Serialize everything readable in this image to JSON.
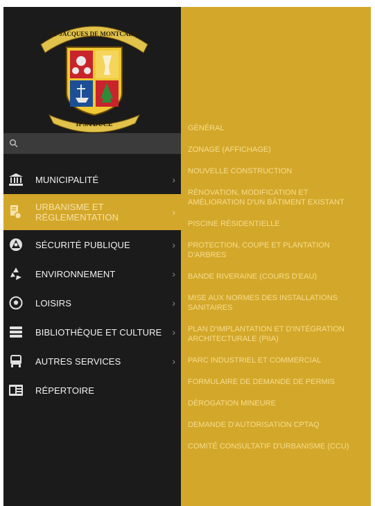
{
  "logo": {
    "banner_top": "ST-JACQUES DE MONTCALM",
    "banner_bottom": "IPSA DUCE"
  },
  "search": {
    "icon": "search-icon"
  },
  "colors": {
    "sidebar_bg": "#1b1b1b",
    "accent": "#d3a72a",
    "submenu_text": "#f6de8e",
    "search_bg": "#3b3b3b"
  },
  "nav": {
    "items": [
      {
        "label": "MUNICIPALITÉ",
        "icon": "bank-icon",
        "chevron": "›"
      },
      {
        "label": "URBANISME ET RÉGLEMENTATION",
        "icon": "document-settings-icon",
        "chevron": "›",
        "active": true
      },
      {
        "label": "SÉCURITÉ PUBLIQUE",
        "icon": "emergency-icon",
        "chevron": "›"
      },
      {
        "label": "ENVIRONNEMENT",
        "icon": "recycle-icon",
        "chevron": "›"
      },
      {
        "label": "LOISIRS",
        "icon": "soccer-ball-icon",
        "chevron": "›"
      },
      {
        "label": "BIBLIOTHÈQUE ET CULTURE",
        "icon": "books-icon",
        "chevron": "›"
      },
      {
        "label": "AUTRES SERVICES",
        "icon": "bus-icon",
        "chevron": "›"
      },
      {
        "label": "RÉPERTOIRE",
        "icon": "directory-icon"
      }
    ]
  },
  "submenu": {
    "items": [
      "GÉNÉRAL",
      "ZONAGE (AFFICHAGE)",
      "NOUVELLE CONSTRUCTION",
      "RÉNOVATION, MODIFICATION ET AMÉLIORATION D'UN BÂTIMENT EXISTANT",
      "PISCINE RÉSIDENTIELLE",
      "PROTECTION, COUPE ET PLANTATION D'ARBRES",
      "BANDE RIVERAINE (COURS D'EAU)",
      "MISE AUX NORMES DES INSTALLATIONS SANITAIRES",
      "PLAN D'IMPLANTATION ET D'INTÉGRATION ARCHITECTURALE (PIIA)",
      "PARC INDUSTRIEL ET COMMERCIAL",
      "FORMULAIRE DE DEMANDE DE PERMIS",
      "DÉROGATION MINEURE",
      "DEMANDE D'AUTORISATION CPTAQ",
      "COMITÉ CONSULTATIF D'URBANISME (CCU)"
    ]
  }
}
